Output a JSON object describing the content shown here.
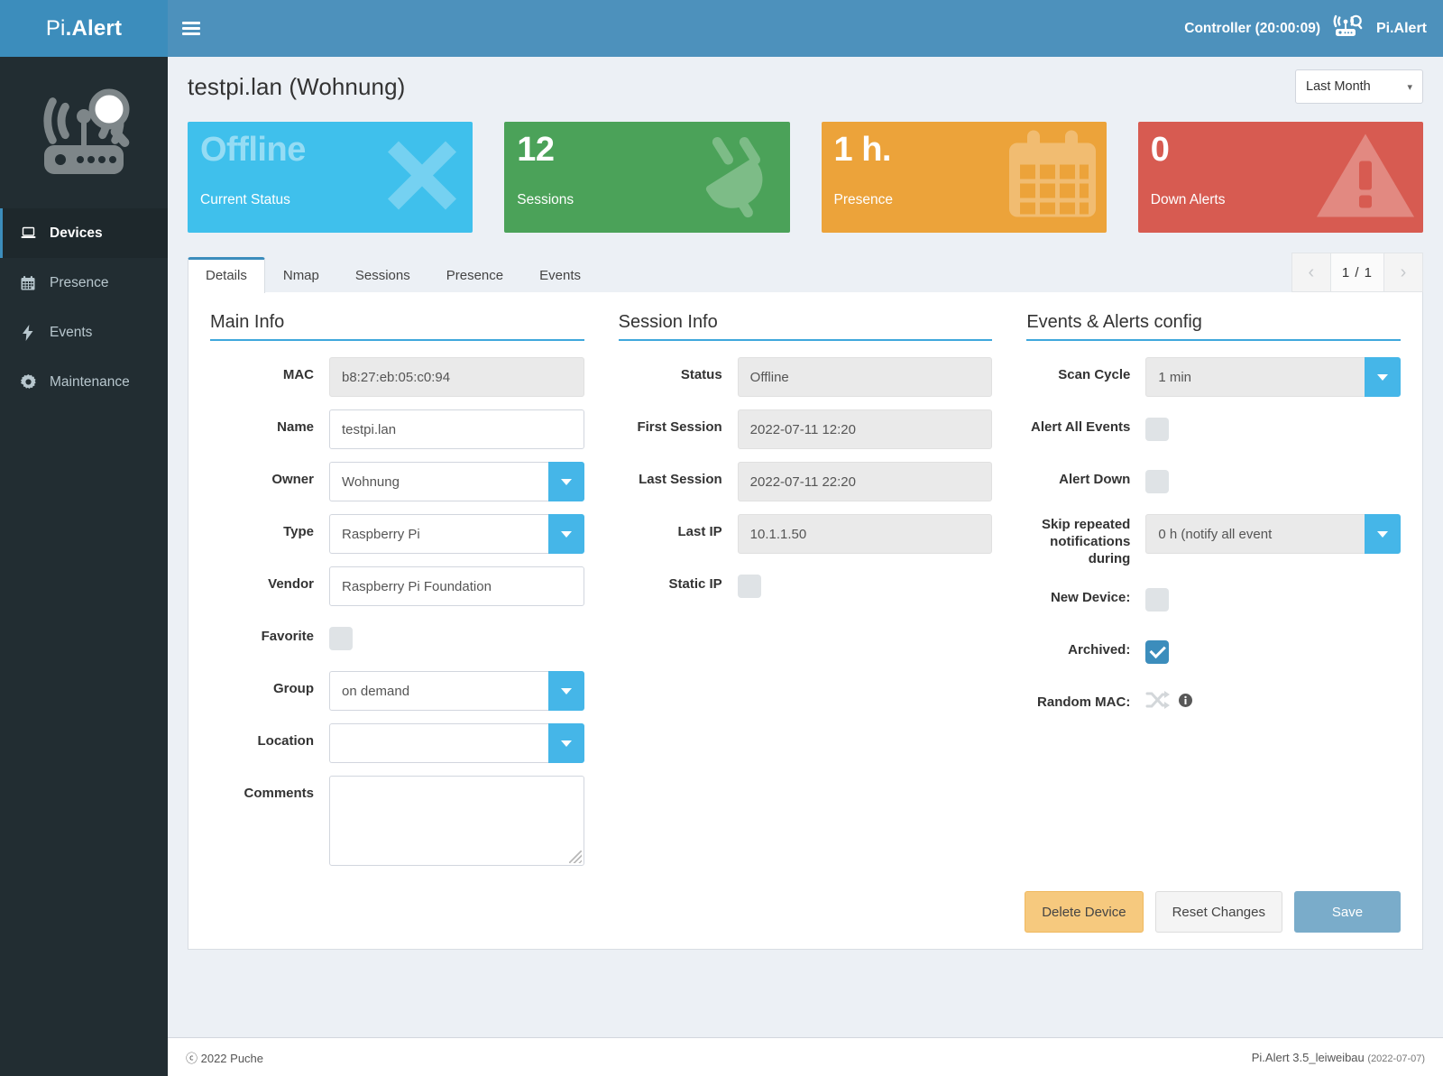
{
  "brand": {
    "prefix": "Pi",
    "suffix": ".Alert"
  },
  "header": {
    "controller": "Controller (20:00:09)",
    "app_name": "Pi.Alert",
    "menu_icon": "hamburger-icon",
    "logo_icon": "router-scan-icon"
  },
  "sidebar": {
    "logo_icon": "router-magnifier-logo",
    "items": [
      {
        "label": "Devices",
        "icon": "laptop-icon",
        "active": true
      },
      {
        "label": "Presence",
        "icon": "calendar-icon",
        "active": false
      },
      {
        "label": "Events",
        "icon": "bolt-icon",
        "active": false
      },
      {
        "label": "Maintenance",
        "icon": "gear-icon",
        "active": false
      }
    ]
  },
  "page": {
    "title": "testpi.lan (Wohnung)",
    "period_value": "Last Month",
    "period_caret": "chevron-down-icon"
  },
  "stats": [
    {
      "value": "Offline",
      "label": "Current Status",
      "color": "#3fc0ec",
      "icon": "times-icon",
      "muted_value": true
    },
    {
      "value": "12",
      "label": "Sessions",
      "color": "#4ba259",
      "icon": "plug-icon",
      "muted_value": false
    },
    {
      "value": "1 h.",
      "label": "Presence",
      "color": "#eca33a",
      "icon": "calendar-icon",
      "muted_value": false
    },
    {
      "value": "0",
      "label": "Down Alerts",
      "color": "#d75b51",
      "icon": "warning-triangle-icon",
      "muted_value": false
    }
  ],
  "tabs": [
    {
      "label": "Details",
      "active": true
    },
    {
      "label": "Nmap",
      "active": false
    },
    {
      "label": "Sessions",
      "active": false
    },
    {
      "label": "Presence",
      "active": false
    },
    {
      "label": "Events",
      "active": false
    }
  ],
  "pager": {
    "prev": "‹",
    "page": "1 / 1",
    "next": "›"
  },
  "main_info": {
    "title": "Main Info",
    "mac_label": "MAC",
    "mac_value": "b8:27:eb:05:c0:94",
    "name_label": "Name",
    "name_value": "testpi.lan",
    "owner_label": "Owner",
    "owner_value": "Wohnung",
    "type_label": "Type",
    "type_value": "Raspberry Pi",
    "vendor_label": "Vendor",
    "vendor_value": "Raspberry Pi Foundation",
    "favorite_label": "Favorite",
    "favorite_checked": false,
    "group_label": "Group",
    "group_value": "on demand",
    "location_label": "Location",
    "location_value": "",
    "comments_label": "Comments",
    "comments_value": ""
  },
  "session_info": {
    "title": "Session Info",
    "status_label": "Status",
    "status_value": "Offline",
    "first_label": "First Session",
    "first_value": "2022-07-11  12:20",
    "last_label": "Last Session",
    "last_value": "2022-07-11  22:20",
    "lastip_label": "Last IP",
    "lastip_value": "10.1.1.50",
    "staticip_label": "Static IP",
    "staticip_checked": false
  },
  "events_config": {
    "title": "Events & Alerts config",
    "scan_label": "Scan Cycle",
    "scan_value": "1 min",
    "alert_all_label": "Alert All Events",
    "alert_all_checked": false,
    "alert_down_label": "Alert Down",
    "alert_down_checked": false,
    "skip_label_1": "Skip repeated",
    "skip_label_2": "notifications during",
    "skip_value": "0 h (notify all event",
    "new_device_label": "New Device:",
    "new_device_checked": false,
    "archived_label": "Archived:",
    "archived_checked": true,
    "random_mac_label": "Random MAC:",
    "random_mac_icon": "shuffle-icon",
    "random_mac_info_icon": "info-circle-icon"
  },
  "actions": {
    "delete": "Delete Device",
    "reset": "Reset Changes",
    "save": "Save"
  },
  "footer": {
    "copyright": "ⓒ 2022 Puche",
    "version": "Pi.Alert  3.5_leiweibau",
    "version_date": "(2022-07-07)"
  },
  "colors": {
    "header_blue": "#4d91bc",
    "logo_blue": "#3c8dbc",
    "sidebar_dark": "#222d32",
    "accent": "#3fa8dc",
    "select_btn": "#45b6e8"
  }
}
